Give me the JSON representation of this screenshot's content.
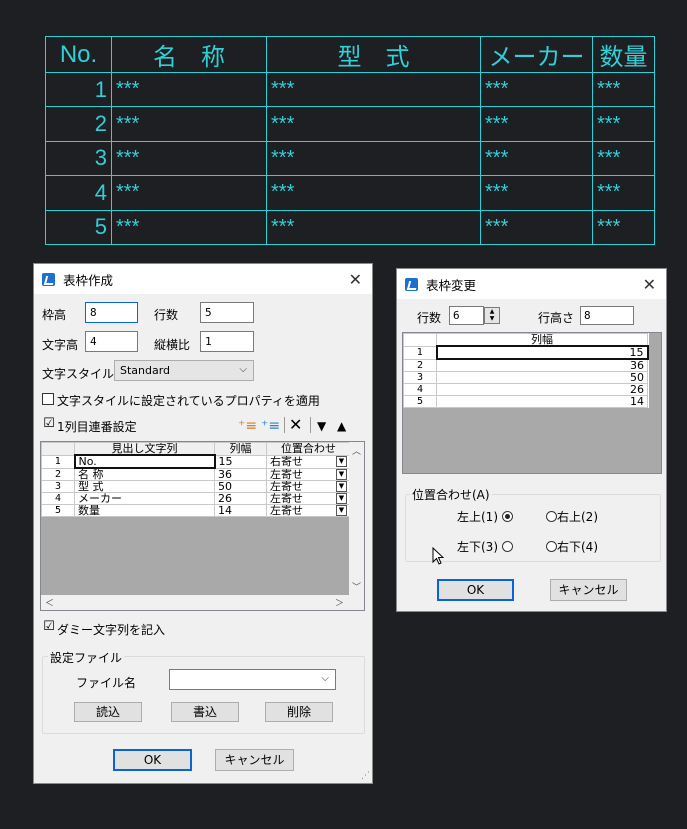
{
  "cad_table": {
    "headers": [
      "No.",
      "名　称",
      "型　式",
      "メーカー",
      "数量"
    ],
    "rows": [
      [
        "1",
        "***",
        "***",
        "***",
        "***"
      ],
      [
        "2",
        "***",
        "***",
        "***",
        "***"
      ],
      [
        "3",
        "***",
        "***",
        "***",
        "***"
      ],
      [
        "4",
        "***",
        "***",
        "***",
        "***"
      ],
      [
        "5",
        "***",
        "***",
        "***",
        "***"
      ]
    ],
    "color": "#2fd0d7"
  },
  "dialog1": {
    "title": "表枠作成",
    "frame_height_label": "枠高",
    "frame_height_value": "8",
    "rows_label": "行数",
    "rows_value": "5",
    "text_height_label": "文字高",
    "text_height_value": "4",
    "aspect_label": "縦横比",
    "aspect_value": "1",
    "text_style_label": "文字スタイル",
    "text_style_value": "Standard",
    "apply_style_props_label": "文字スタイルに設定されているプロパティを適用",
    "serial_label": "1列目連番設定",
    "serial_checked": "☑",
    "grid_headers": [
      "見出し文字列",
      "列幅",
      "位置合わせ"
    ],
    "grid_rows": [
      {
        "n": "1",
        "heading": "No.",
        "width": "15",
        "align": "右寄せ"
      },
      {
        "n": "2",
        "heading": "名 称",
        "width": "36",
        "align": "左寄せ"
      },
      {
        "n": "3",
        "heading": "型 式",
        "width": "50",
        "align": "左寄せ"
      },
      {
        "n": "4",
        "heading": "メーカー",
        "width": "26",
        "align": "左寄せ"
      },
      {
        "n": "5",
        "heading": "数量",
        "width": "14",
        "align": "左寄せ"
      }
    ],
    "dummy_label": "ダミー文字列を記入",
    "dummy_checked": "☑",
    "settings_group": "設定ファイル",
    "file_name_label": "ファイル名",
    "file_name_value": "",
    "read_button": "読込",
    "write_button": "書込",
    "delete_button": "削除",
    "ok_button": "OK",
    "cancel_button": "キャンセル"
  },
  "dialog2": {
    "title": "表枠変更",
    "rows_label": "行数",
    "rows_value": "6",
    "row_height_label": "行高さ",
    "row_height_value": "8",
    "grid_header": "列幅",
    "grid_rows": [
      {
        "n": "1",
        "width": "15"
      },
      {
        "n": "2",
        "width": "36"
      },
      {
        "n": "3",
        "width": "50"
      },
      {
        "n": "4",
        "width": "26"
      },
      {
        "n": "5",
        "width": "14"
      }
    ],
    "align_group": "位置合わせ(A)",
    "top_left": "左上(1)",
    "top_right": "右上(2)",
    "bottom_left": "左下(3)",
    "bottom_right": "右下(4)",
    "ok_button": "OK",
    "cancel_button": "キャンセル"
  },
  "icons": [
    "app-icon",
    "close-icon",
    "insert-row-icon",
    "insert-after-icon",
    "delete-icon",
    "move-down-icon",
    "move-up-icon",
    "chevron-down-icon",
    "spin-up-icon",
    "spin-down-icon",
    "mouse-cursor-icon"
  ],
  "colors": {
    "background": "#1e1f22",
    "cad_line": "#2fd0d7",
    "accent": "#0a64d6"
  }
}
